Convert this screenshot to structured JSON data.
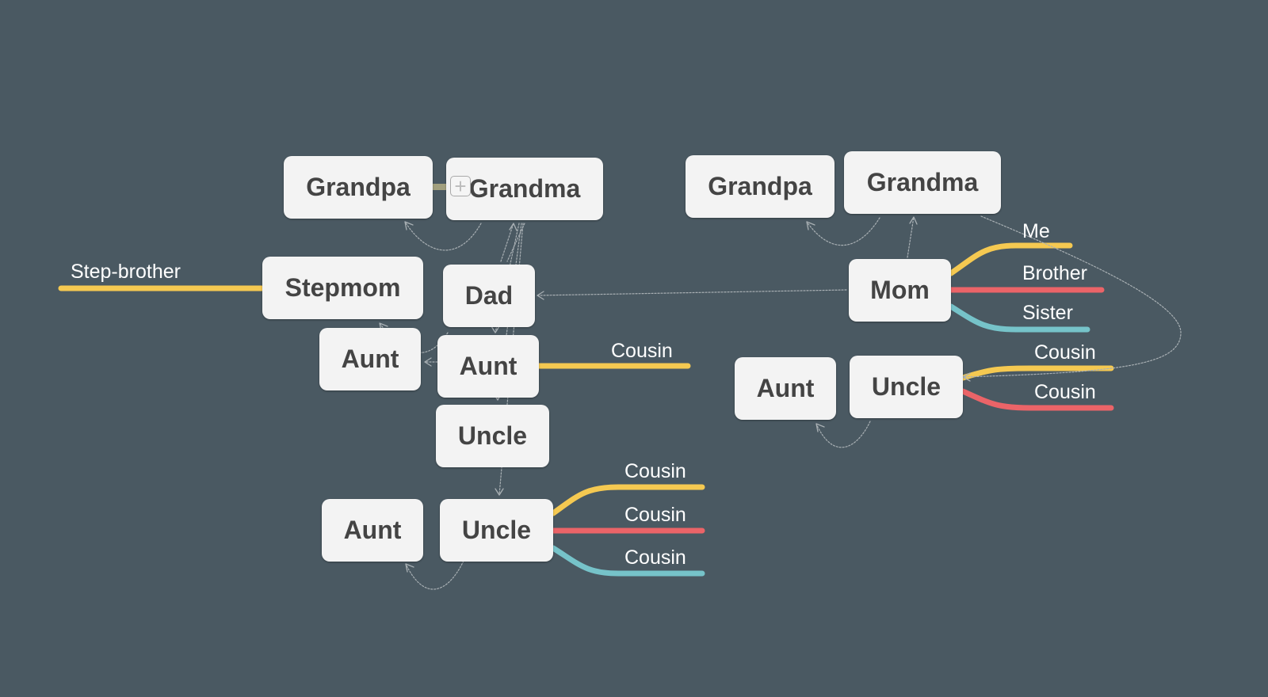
{
  "colors": {
    "background": "#4a5962",
    "node": "#f3f3f3",
    "text": "#444444",
    "yellow": "#f5c951",
    "red": "#eb6468",
    "teal": "#76c3c9",
    "link": "#a9b0b4"
  },
  "nodes": {
    "grandpa_l": "Grandpa",
    "grandma_l": "Grandma",
    "stepmom": "Stepmom",
    "dad": "Dad",
    "aunt_l1": "Aunt",
    "aunt_l2": "Aunt",
    "uncle_l1": "Uncle",
    "aunt_l3": "Aunt",
    "uncle_l2": "Uncle",
    "grandpa_r": "Grandpa",
    "grandma_r": "Grandma",
    "mom": "Mom",
    "aunt_r": "Aunt",
    "uncle_r": "Uncle"
  },
  "branches": {
    "stepbrother": "Step-brother",
    "aunt_cousin": "Cousin",
    "uncle_l_cousins": [
      "Cousin",
      "Cousin",
      "Cousin"
    ],
    "mom_children": [
      "Me",
      "Brother",
      "Sister"
    ],
    "uncle_r_cousins": [
      "Cousin",
      "Cousin"
    ]
  },
  "icons": {
    "add": "plus-icon"
  }
}
